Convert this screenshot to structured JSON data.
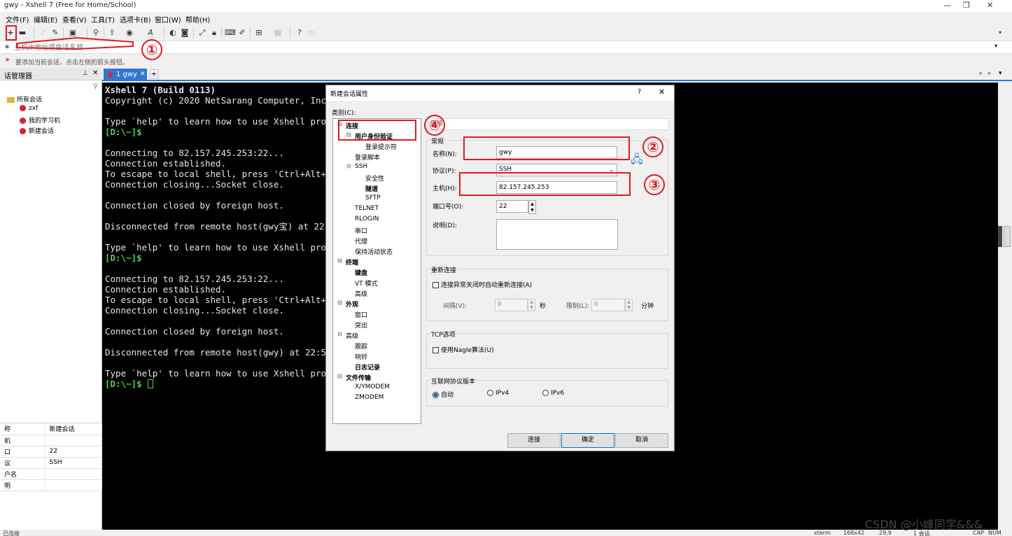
{
  "window": {
    "title": "gwy - Xshell 7 (Free for Home/School)"
  },
  "menu": [
    "文件(F)",
    "编辑(E)",
    "查看(V)",
    "工具(T)",
    "选项卡(B)",
    "窗口(W)",
    "帮助(H)"
  ],
  "address": {
    "placeholder": "主机IP地址或会话名称"
  },
  "hint": "要添加当前会话，点击左侧的箭头按钮。",
  "session_manager": {
    "title": "话管理器",
    "root": "所有会话",
    "items": [
      "zxf",
      "我的学习机",
      "新建会话"
    ],
    "props": [
      [
        "称",
        "新建会话"
      ],
      [
        "机",
        ""
      ],
      [
        "口",
        "22"
      ],
      [
        "议",
        "SSH"
      ],
      [
        "户名",
        ""
      ],
      [
        "明",
        ""
      ]
    ]
  },
  "tab": {
    "label": "1 gwy"
  },
  "terminal": {
    "lines": [
      {
        "t": "Xshell 7 (Build 0113)",
        "c": "bold"
      },
      {
        "t": "Copyright (c) 2020 NetSarang Computer, Inc",
        "c": ""
      },
      {
        "t": "",
        "c": ""
      },
      {
        "t": "Type `help' to learn how to use Xshell pro",
        "c": ""
      },
      {
        "t": "[D:\\~]$",
        "c": "green"
      },
      {
        "t": "",
        "c": ""
      },
      {
        "t": "Connecting to 82.157.245.253:22...",
        "c": ""
      },
      {
        "t": "Connection established.",
        "c": ""
      },
      {
        "t": "To escape to local shell, press 'Ctrl+Alt+",
        "c": ""
      },
      {
        "t": "Connection closing...Socket close.",
        "c": ""
      },
      {
        "t": "",
        "c": ""
      },
      {
        "t": "Connection closed by foreign host.",
        "c": ""
      },
      {
        "t": "",
        "c": ""
      },
      {
        "t": "Disconnected from remote host(gwy宝) at 22",
        "c": ""
      },
      {
        "t": "",
        "c": ""
      },
      {
        "t": "Type `help' to learn how to use Xshell pro",
        "c": ""
      },
      {
        "t": "[D:\\~]$",
        "c": "green"
      },
      {
        "t": "",
        "c": ""
      },
      {
        "t": "Connecting to 82.157.245.253:22...",
        "c": ""
      },
      {
        "t": "Connection established.",
        "c": ""
      },
      {
        "t": "To escape to local shell, press 'Ctrl+Alt+",
        "c": ""
      },
      {
        "t": "Connection closing...Socket close.",
        "c": ""
      },
      {
        "t": "",
        "c": ""
      },
      {
        "t": "Connection closed by foreign host.",
        "c": ""
      },
      {
        "t": "",
        "c": ""
      },
      {
        "t": "Disconnected from remote host(gwy) at 22:5",
        "c": ""
      },
      {
        "t": "",
        "c": ""
      },
      {
        "t": "Type `help' to learn how to use Xshell pro",
        "c": ""
      },
      {
        "t": "[D:\\~]$ ",
        "c": "green"
      }
    ]
  },
  "dialog": {
    "title": "新建会话属性",
    "category_label": "类别(C):",
    "section_connect": "连接",
    "group_general": "常规",
    "name_label": "名称(N):",
    "name_value": "gwy",
    "protocol_label": "协议(P):",
    "protocol_value": "SSH",
    "host_label": "主机(H):",
    "host_value": "82.157.245.253",
    "port_label": "端口号(O):",
    "port_value": "22",
    "desc_label": "说明(D):",
    "group_reconnect": "重新连接",
    "reconnect_check": "连接异常关闭时自动重新连接(A)",
    "interval_label": "间隔(V):",
    "interval_value": "0",
    "interval_unit": "秒",
    "limit_label": "限制(L):",
    "limit_value": "0",
    "limit_unit": "分钟",
    "group_tcp": "TCP选项",
    "nagle_check": "使用Nagle算法(U)",
    "group_ip": "互联网协议版本",
    "ip_auto": "自动",
    "ip_v4": "IPv4",
    "ip_v6": "IPv6",
    "btn_connect": "连接",
    "btn_ok": "确定",
    "btn_cancel": "取消",
    "tree": [
      {
        "label": "连接",
        "level": 0,
        "bold": true
      },
      {
        "label": "用户身份验证",
        "level": 1,
        "bold": true
      },
      {
        "label": "登录提示符",
        "level": 2,
        "bold": false
      },
      {
        "label": "登录脚本",
        "level": 1,
        "bold": false
      },
      {
        "label": "SSH",
        "level": 1,
        "bold": false
      },
      {
        "label": "安全性",
        "level": 2,
        "bold": false
      },
      {
        "label": "隧道",
        "level": 2,
        "bold": true
      },
      {
        "label": "SFTP",
        "level": 2,
        "bold": false
      },
      {
        "label": "TELNET",
        "level": 1,
        "bold": false
      },
      {
        "label": "RLOGIN",
        "level": 1,
        "bold": false
      },
      {
        "label": "串口",
        "level": 1,
        "bold": false
      },
      {
        "label": "代理",
        "level": 1,
        "bold": false
      },
      {
        "label": "保持活动状态",
        "level": 1,
        "bold": false
      },
      {
        "label": "终端",
        "level": 0,
        "bold": true
      },
      {
        "label": "键盘",
        "level": 1,
        "bold": true
      },
      {
        "label": "VT 模式",
        "level": 1,
        "bold": false
      },
      {
        "label": "高级",
        "level": 1,
        "bold": false
      },
      {
        "label": "外观",
        "level": 0,
        "bold": true
      },
      {
        "label": "窗口",
        "level": 1,
        "bold": false
      },
      {
        "label": "突出",
        "level": 1,
        "bold": false
      },
      {
        "label": "高级",
        "level": 0,
        "bold": false
      },
      {
        "label": "跟踪",
        "level": 1,
        "bold": false
      },
      {
        "label": "响铃",
        "level": 1,
        "bold": false
      },
      {
        "label": "日志记录",
        "level": 1,
        "bold": true
      },
      {
        "label": "文件传输",
        "level": 0,
        "bold": true
      },
      {
        "label": "X/YMODEM",
        "level": 1,
        "bold": false
      },
      {
        "label": "ZMODEM",
        "level": 1,
        "bold": false
      }
    ]
  },
  "annotations": [
    "①",
    "②",
    "③",
    "④"
  ],
  "status": {
    "left": "已连接",
    "term": "xterm",
    "size": "168x42",
    "pos": "29,9",
    "sessions": "1 会话",
    "caps": "CAP",
    "num": "NUM"
  },
  "watermark": "CSDN @小峰同学&&&",
  "colors": {
    "accent": "#3078d0",
    "annotation": "#e01b1b",
    "prompt": "#4cd24c"
  }
}
